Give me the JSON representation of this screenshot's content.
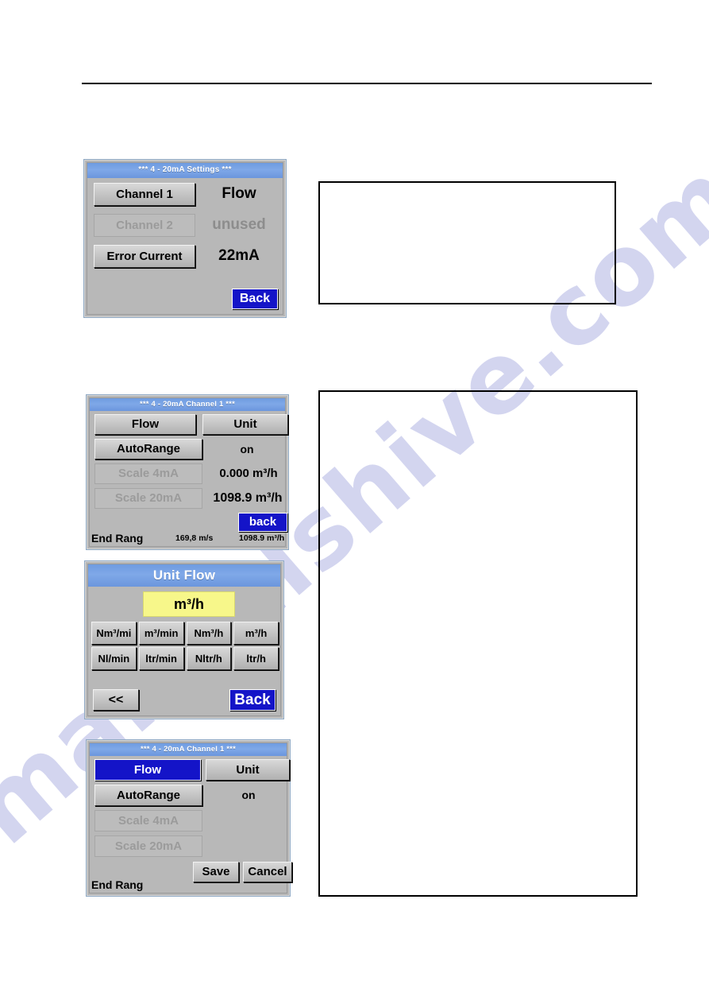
{
  "page": {
    "watermark_text": "manualshive.com"
  },
  "panel_settings": {
    "title": "***   4 - 20mA Settings ***",
    "rows": [
      {
        "label": "Channel 1",
        "value": "Flow",
        "disabled": false
      },
      {
        "label": "Channel 2",
        "value": "unused",
        "disabled": true
      },
      {
        "label": "Error Current",
        "value": "22mA",
        "disabled": false
      }
    ],
    "back_label": "Back"
  },
  "panel_channel1_values": {
    "title": "***   4 - 20mA Channel 1 ***",
    "flow_label": "Flow",
    "unit_label": "Unit",
    "autorange_label": "AutoRange",
    "autorange_value": "on",
    "scale4_label": "Scale 4mA",
    "scale4_value": "0.000 m³/h",
    "scale20_label": "Scale 20mA",
    "scale20_value": "1098.9 m³/h",
    "back_label": "back",
    "end_range_label": "End Rang",
    "end_range_value_1": "169,8 m/s",
    "end_range_value_2": "1098.9 m³/h"
  },
  "panel_unit_flow": {
    "title": "Unit Flow",
    "selected_unit": "m³/h",
    "units": [
      "Nm³/mi",
      "m³/min",
      "Nm³/h",
      "m³/h",
      "Nl/min",
      "ltr/min",
      "Nltr/h",
      "ltr/h"
    ],
    "prev_label": "<<",
    "back_label": "Back"
  },
  "panel_channel1_edit": {
    "title": "***   4 - 20mA Channel 1 ***",
    "flow_label": "Flow",
    "unit_label": "Unit",
    "autorange_label": "AutoRange",
    "autorange_value": "on",
    "scale4_label": "Scale 4mA",
    "scale20_label": "Scale 20mA",
    "save_label": "Save",
    "cancel_label": "Cancel",
    "end_range_label": "End Rang"
  },
  "colors": {
    "titlebar_blue": "#7fa8e8",
    "button_blue": "#1414c8",
    "selection_yellow": "#f7f78a",
    "screen_gray": "#b8b8b8",
    "watermark": "#c3c6ea"
  }
}
